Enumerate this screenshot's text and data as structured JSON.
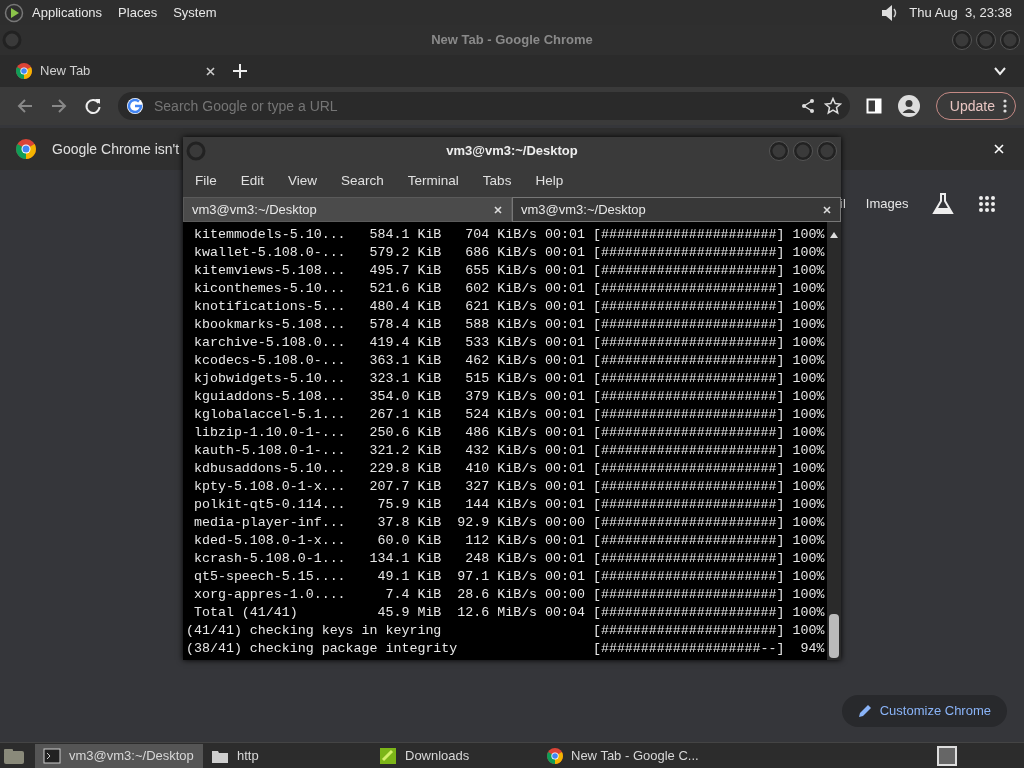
{
  "top_panel": {
    "menus": [
      "Applications",
      "Places",
      "System"
    ],
    "clock": "Thu Aug  3, 23:38"
  },
  "chrome": {
    "title": "New Tab - Google Chrome",
    "tabs": [
      {
        "label": "New Tab",
        "selected": true
      }
    ],
    "omnibox": {
      "placeholder": "Search Google or type a URL"
    },
    "update_button": "Update",
    "infobar": {
      "text": "Google Chrome isn't"
    },
    "header_links": [
      "il",
      "Images"
    ],
    "customize_button": "Customize Chrome"
  },
  "terminal": {
    "title": "vm3@vm3:~/Desktop",
    "menus": [
      "File",
      "Edit",
      "View",
      "Search",
      "Terminal",
      "Tabs",
      "Help"
    ],
    "tabs": [
      {
        "label": "vm3@vm3:~/Desktop",
        "selected": false
      },
      {
        "label": "vm3@vm3:~/Desktop",
        "selected": true
      }
    ],
    "lines": [
      " kitemmodels-5.10...   584.1 KiB   704 KiB/s 00:01 [######################] 100%",
      " kwallet-5.108.0-...   579.2 KiB   686 KiB/s 00:01 [######################] 100%",
      " kitemviews-5.108...   495.7 KiB   655 KiB/s 00:01 [######################] 100%",
      " kiconthemes-5.10...   521.6 KiB   602 KiB/s 00:01 [######################] 100%",
      " knotifications-5...   480.4 KiB   621 KiB/s 00:01 [######################] 100%",
      " kbookmarks-5.108...   578.4 KiB   588 KiB/s 00:01 [######################] 100%",
      " karchive-5.108.0...   419.4 KiB   533 KiB/s 00:01 [######################] 100%",
      " kcodecs-5.108.0-...   363.1 KiB   462 KiB/s 00:01 [######################] 100%",
      " kjobwidgets-5.10...   323.1 KiB   515 KiB/s 00:01 [######################] 100%",
      " kguiaddons-5.108...   354.0 KiB   379 KiB/s 00:01 [######################] 100%",
      " kglobalaccel-5.1...   267.1 KiB   524 KiB/s 00:01 [######################] 100%",
      " libzip-1.10.0-1-...   250.6 KiB   486 KiB/s 00:01 [######################] 100%",
      " kauth-5.108.0-1-...   321.2 KiB   432 KiB/s 00:01 [######################] 100%",
      " kdbusaddons-5.10...   229.8 KiB   410 KiB/s 00:01 [######################] 100%",
      " kpty-5.108.0-1-x...   207.7 KiB   327 KiB/s 00:01 [######################] 100%",
      " polkit-qt5-0.114...    75.9 KiB   144 KiB/s 00:01 [######################] 100%",
      " media-player-inf...    37.8 KiB  92.9 KiB/s 00:00 [######################] 100%",
      " kded-5.108.0-1-x...    60.0 KiB   112 KiB/s 00:01 [######################] 100%",
      " kcrash-5.108.0-1...   134.1 KiB   248 KiB/s 00:01 [######################] 100%",
      " qt5-speech-5.15....    49.1 KiB  97.1 KiB/s 00:01 [######################] 100%",
      " xorg-appres-1.0....     7.4 KiB  28.6 KiB/s 00:00 [######################] 100%",
      " Total (41/41)          45.9 MiB  12.6 MiB/s 00:04 [######################] 100%",
      "(41/41) checking keys in keyring                   [######################] 100%",
      "(38/41) checking package integrity                 [####################--]  94%"
    ]
  },
  "taskbar": {
    "items": [
      {
        "label": "vm3@vm3:~/Desktop",
        "kind": "terminal",
        "selected": true
      },
      {
        "label": "http",
        "kind": "folder",
        "selected": false
      },
      {
        "label": "Downloads",
        "kind": "downloads",
        "selected": false
      },
      {
        "label": "New Tab - Google C...",
        "kind": "chrome",
        "selected": false
      }
    ]
  }
}
